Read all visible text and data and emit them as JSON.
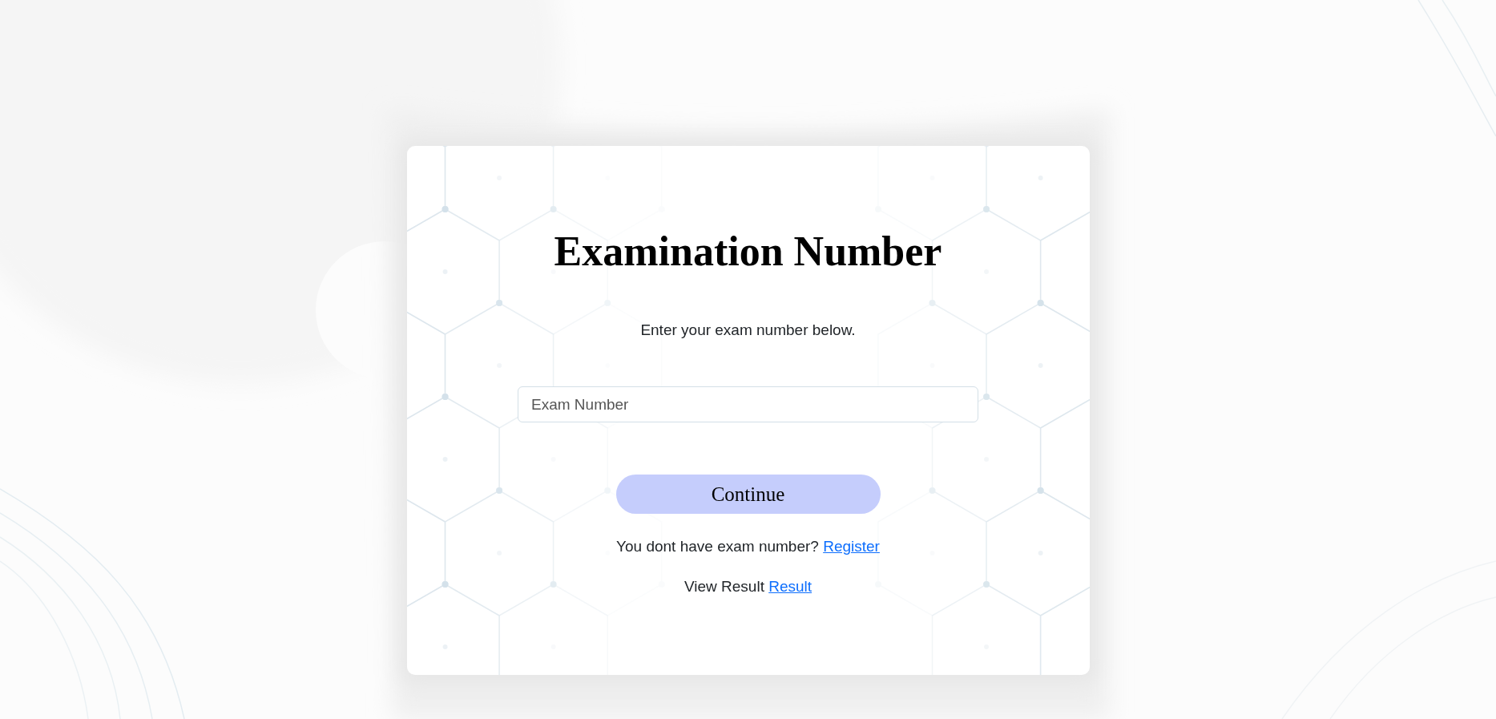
{
  "page": {
    "title": "Examination Number",
    "instruction": "Enter your exam number below.",
    "exam_number_field": {
      "placeholder": "Exam Number"
    },
    "continue_button": {
      "label": "Continue"
    },
    "links": [
      {
        "text": "You dont have exam number?",
        "link": "Register"
      },
      {
        "text": "View Result",
        "link": "Result"
      }
    ]
  }
}
